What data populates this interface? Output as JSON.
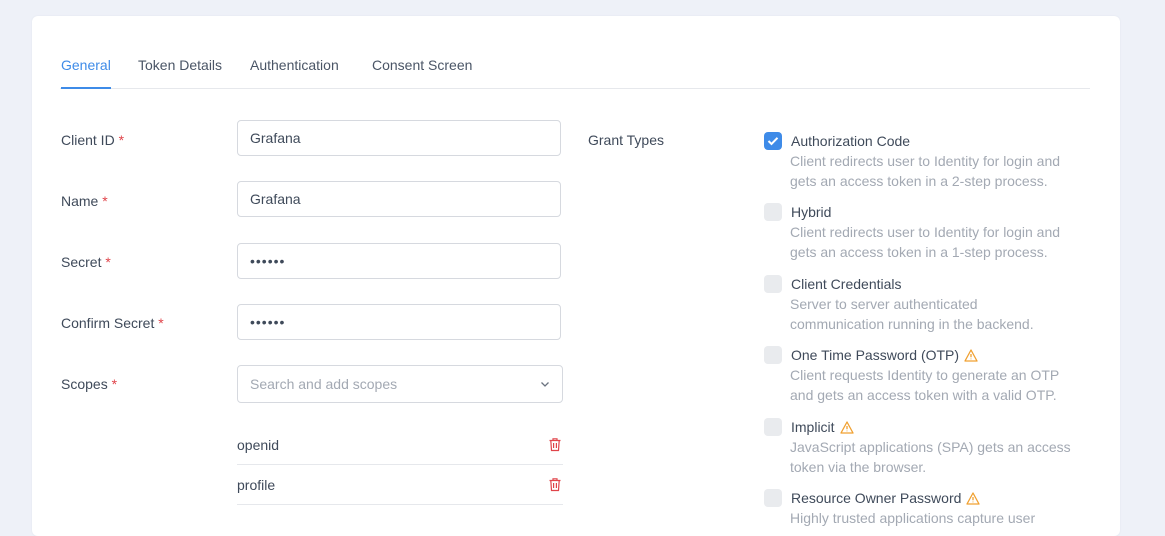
{
  "tabs": [
    {
      "label": "General",
      "active": true
    },
    {
      "label": "Token Details",
      "active": false
    },
    {
      "label": "Authentication",
      "active": false
    },
    {
      "label": "Consent Screen",
      "active": false
    }
  ],
  "form": {
    "client_id": {
      "label": "Client ID",
      "required": "*",
      "value": "Grafana"
    },
    "name": {
      "label": "Name",
      "required": "*",
      "value": "Grafana"
    },
    "secret": {
      "label": "Secret",
      "required": "*",
      "value": "••••••"
    },
    "confirm_secret": {
      "label": "Confirm Secret",
      "required": "*",
      "value": "••••••"
    },
    "scopes": {
      "label": "Scopes",
      "required": "*",
      "placeholder": "Search and add scopes",
      "items": [
        "openid",
        "profile"
      ]
    }
  },
  "grant_types": {
    "label": "Grant Types",
    "items": [
      {
        "title": "Authorization Code",
        "checked": true,
        "warning": false,
        "desc_line1": "Client redirects user to Identity for login and",
        "desc_line2": "gets an access token in a 2-step process."
      },
      {
        "title": "Hybrid",
        "checked": false,
        "warning": false,
        "desc_line1": "Client redirects user to Identity for login and",
        "desc_line2": "gets an access token in a 1-step process."
      },
      {
        "title": "Client Credentials",
        "checked": false,
        "warning": false,
        "desc_line1": "Server to server authenticated",
        "desc_line2": "communication running in the backend."
      },
      {
        "title": "One Time Password (OTP)",
        "checked": false,
        "warning": true,
        "desc_line1": "Client requests Identity to generate an OTP",
        "desc_line2": "and gets an access token with a valid OTP."
      },
      {
        "title": "Implicit",
        "checked": false,
        "warning": true,
        "desc_line1": "JavaScript applications (SPA) gets an access",
        "desc_line2": "token via the browser."
      },
      {
        "title": "Resource Owner Password",
        "checked": false,
        "warning": true,
        "desc_line1": "Highly trusted applications capture user",
        "desc_line2": ""
      }
    ]
  },
  "colors": {
    "accent": "#3e8be8",
    "required": "#e0444a",
    "warning": "#f0a030",
    "delete": "#e0444a"
  }
}
